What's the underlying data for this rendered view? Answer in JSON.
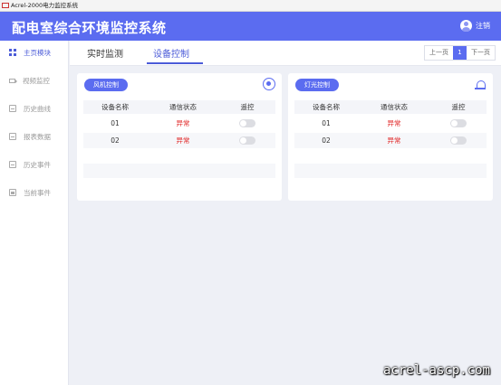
{
  "window": {
    "title": "Acrel-2000电力监控系统"
  },
  "header": {
    "app_title": "配电室综合环境监控系统",
    "logout_label": "注销"
  },
  "sidebar": {
    "items": [
      {
        "label": "主页模块",
        "icon": "grid-icon",
        "active": true
      },
      {
        "label": "视频监控",
        "icon": "video-camera-icon"
      },
      {
        "label": "历史曲线",
        "icon": "chart-document-icon"
      },
      {
        "label": "报表数据",
        "icon": "report-icon"
      },
      {
        "label": "历史事件",
        "icon": "history-event-icon"
      },
      {
        "label": "当前事件",
        "icon": "current-event-icon"
      }
    ]
  },
  "tabs": [
    {
      "label": "实时监测"
    },
    {
      "label": "设备控制",
      "active": true
    }
  ],
  "pager": {
    "prev": "上一页",
    "current": "1",
    "next": "下一页"
  },
  "cards": [
    {
      "title": "风机控制",
      "icon": "fan-icon",
      "headers": [
        "设备名称",
        "通信状态",
        "遥控"
      ],
      "rows": [
        {
          "name": "01",
          "status": "异常",
          "remote": "off"
        },
        {
          "name": "02",
          "status": "异常",
          "remote": "off"
        }
      ]
    },
    {
      "title": "灯光控制",
      "icon": "alarm-light-icon",
      "headers": [
        "设备名称",
        "通信状态",
        "遥控"
      ],
      "rows": [
        {
          "name": "01",
          "status": "异常",
          "remote": "off"
        },
        {
          "name": "02",
          "status": "异常",
          "remote": "off"
        }
      ]
    }
  ],
  "colors": {
    "primary": "#5b6cf0",
    "abnormal": "#e02020",
    "background": "#eef0f6"
  },
  "watermark": "acrel-ascp.com"
}
